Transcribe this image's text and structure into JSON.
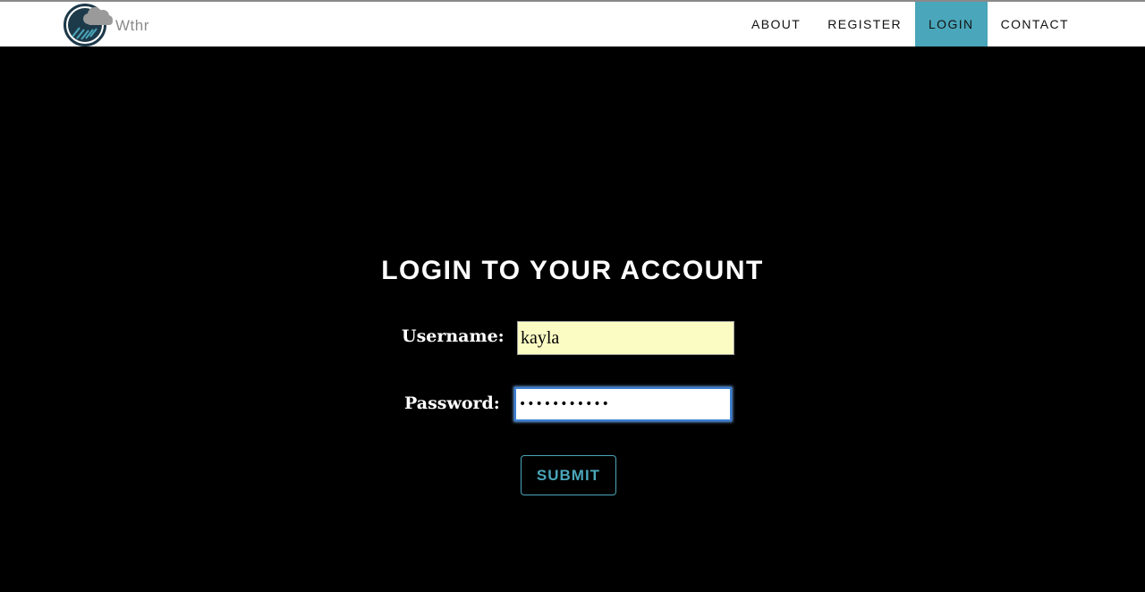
{
  "brand": {
    "name": "Wthr",
    "logo_icon": "cloud-rain-icon"
  },
  "nav": {
    "items": [
      {
        "label": "ABOUT"
      },
      {
        "label": "REGISTER"
      },
      {
        "label": "LOGIN",
        "active": true
      },
      {
        "label": "CONTACT"
      }
    ]
  },
  "form": {
    "heading": "LOGIN TO YOUR ACCOUNT",
    "username_label": "Username:",
    "username_value": "kayla",
    "password_label": "Password:",
    "password_value": "kaylapasswd",
    "submit_label": "SUBMIT"
  },
  "colors": {
    "accent": "#4aa6ba",
    "background": "#000000",
    "autofill": "#fbfcc4",
    "logo_dark": "#1d3a4a"
  }
}
